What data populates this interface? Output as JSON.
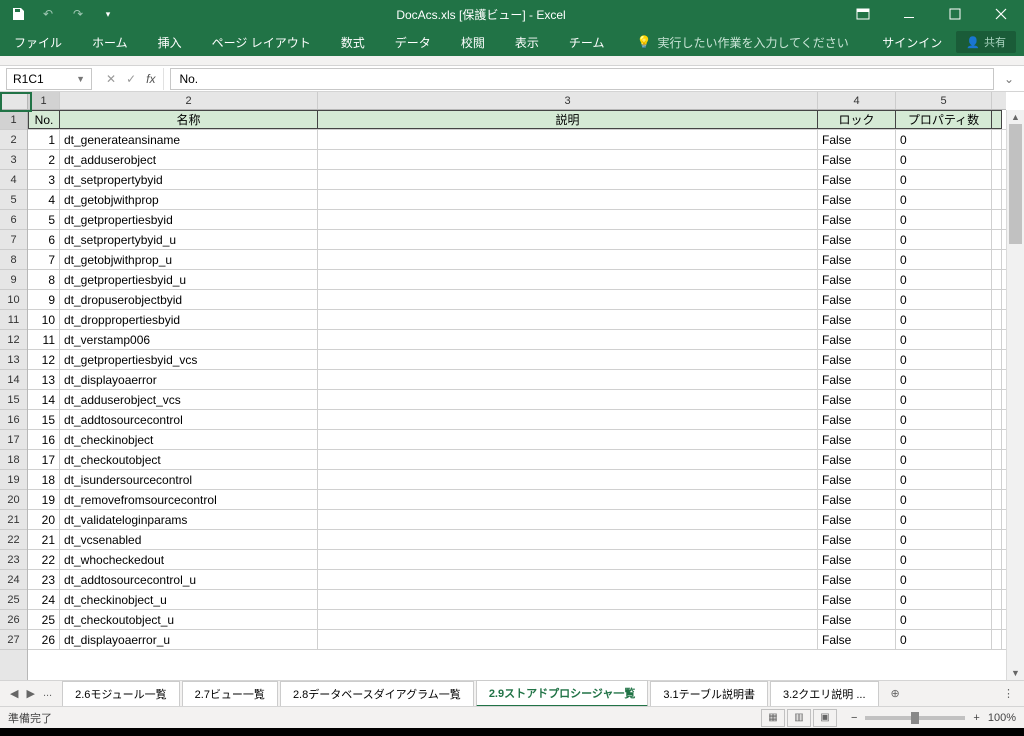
{
  "title": "DocAcs.xls  [保護ビュー] - Excel",
  "qat": {
    "save": "💾"
  },
  "ribbon": {
    "file": "ファイル",
    "home": "ホーム",
    "insert": "挿入",
    "layout": "ページ レイアウト",
    "formulas": "数式",
    "data": "データ",
    "review": "校閲",
    "view": "表示",
    "team": "チーム",
    "tellme": "実行したい作業を入力してください",
    "signin": "サインイン",
    "share": "共有"
  },
  "namebox": "R1C1",
  "formula": "No.",
  "col_numbers": [
    "1",
    "2",
    "3",
    "4",
    "5"
  ],
  "headers": {
    "no": "No.",
    "name": "名称",
    "desc": "説明",
    "lock": "ロック",
    "prop": "プロパティ数"
  },
  "rows": [
    {
      "n": 1,
      "name": "dt_generateansiname",
      "lock": "False",
      "prop": "0"
    },
    {
      "n": 2,
      "name": "dt_adduserobject",
      "lock": "False",
      "prop": "0"
    },
    {
      "n": 3,
      "name": "dt_setpropertybyid",
      "lock": "False",
      "prop": "0"
    },
    {
      "n": 4,
      "name": "dt_getobjwithprop",
      "lock": "False",
      "prop": "0"
    },
    {
      "n": 5,
      "name": "dt_getpropertiesbyid",
      "lock": "False",
      "prop": "0"
    },
    {
      "n": 6,
      "name": "dt_setpropertybyid_u",
      "lock": "False",
      "prop": "0"
    },
    {
      "n": 7,
      "name": "dt_getobjwithprop_u",
      "lock": "False",
      "prop": "0"
    },
    {
      "n": 8,
      "name": "dt_getpropertiesbyid_u",
      "lock": "False",
      "prop": "0"
    },
    {
      "n": 9,
      "name": "dt_dropuserobjectbyid",
      "lock": "False",
      "prop": "0"
    },
    {
      "n": 10,
      "name": "dt_droppropertiesbyid",
      "lock": "False",
      "prop": "0"
    },
    {
      "n": 11,
      "name": "dt_verstamp006",
      "lock": "False",
      "prop": "0"
    },
    {
      "n": 12,
      "name": "dt_getpropertiesbyid_vcs",
      "lock": "False",
      "prop": "0"
    },
    {
      "n": 13,
      "name": "dt_displayoaerror",
      "lock": "False",
      "prop": "0"
    },
    {
      "n": 14,
      "name": "dt_adduserobject_vcs",
      "lock": "False",
      "prop": "0"
    },
    {
      "n": 15,
      "name": "dt_addtosourcecontrol",
      "lock": "False",
      "prop": "0"
    },
    {
      "n": 16,
      "name": "dt_checkinobject",
      "lock": "False",
      "prop": "0"
    },
    {
      "n": 17,
      "name": "dt_checkoutobject",
      "lock": "False",
      "prop": "0"
    },
    {
      "n": 18,
      "name": "dt_isundersourcecontrol",
      "lock": "False",
      "prop": "0"
    },
    {
      "n": 19,
      "name": "dt_removefromsourcecontrol",
      "lock": "False",
      "prop": "0"
    },
    {
      "n": 20,
      "name": "dt_validateloginparams",
      "lock": "False",
      "prop": "0"
    },
    {
      "n": 21,
      "name": "dt_vcsenabled",
      "lock": "False",
      "prop": "0"
    },
    {
      "n": 22,
      "name": "dt_whocheckedout",
      "lock": "False",
      "prop": "0"
    },
    {
      "n": 23,
      "name": "dt_addtosourcecontrol_u",
      "lock": "False",
      "prop": "0"
    },
    {
      "n": 24,
      "name": "dt_checkinobject_u",
      "lock": "False",
      "prop": "0"
    },
    {
      "n": 25,
      "name": "dt_checkoutobject_u",
      "lock": "False",
      "prop": "0"
    },
    {
      "n": 26,
      "name": "dt_displayoaerror_u",
      "lock": "False",
      "prop": "0"
    }
  ],
  "sheet_tabs": {
    "prev_ellipsis": "...",
    "t1": "2.6モジュール一覧",
    "t2": "2.7ビュー一覧",
    "t3": "2.8データベースダイアグラム一覧",
    "t4": "2.9ストアドプロシージャ一覧",
    "t5": "3.1テーブル説明書",
    "t6": "3.2クエリ説明 ..."
  },
  "status": {
    "ready": "準備完了",
    "zoom": "100%"
  }
}
